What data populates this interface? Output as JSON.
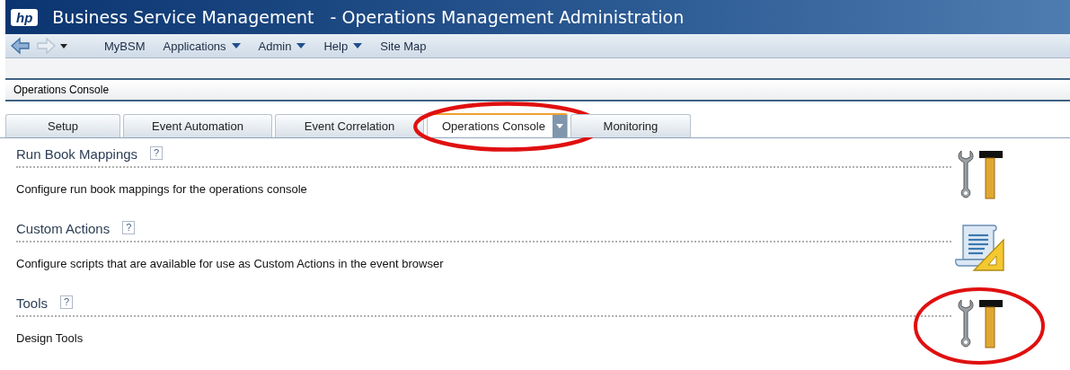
{
  "header": {
    "logo": "hp",
    "title": "Business Service Management",
    "subtitle": "- Operations Management Administration"
  },
  "menu": [
    {
      "label": "MyBSM",
      "dropdown": false
    },
    {
      "label": "Applications",
      "dropdown": true
    },
    {
      "label": "Admin",
      "dropdown": true
    },
    {
      "label": "Help",
      "dropdown": true
    },
    {
      "label": "Site Map",
      "dropdown": false
    }
  ],
  "breadcrumb": "Operations Console",
  "tabs": [
    {
      "label": "Setup",
      "selected": false,
      "circled": false
    },
    {
      "label": "Event Automation",
      "selected": false,
      "circled": false
    },
    {
      "label": "Event Correlation",
      "selected": false,
      "circled": false
    },
    {
      "label": "Operations Console",
      "selected": true,
      "circled": true
    },
    {
      "label": "Monitoring",
      "selected": false,
      "circled": false
    }
  ],
  "sections": [
    {
      "title": "Run Book Mappings",
      "help": "?",
      "description": "Configure run book mappings for the operations console",
      "kind": "tools",
      "circled": false
    },
    {
      "title": "Custom Actions",
      "help": "?",
      "description": "Configure scripts that are available for use as Custom Actions in the event browser",
      "kind": "script",
      "circled": false
    },
    {
      "title": "Tools",
      "help": "?",
      "description": "Design Tools",
      "kind": "tools",
      "circled": true
    }
  ]
}
